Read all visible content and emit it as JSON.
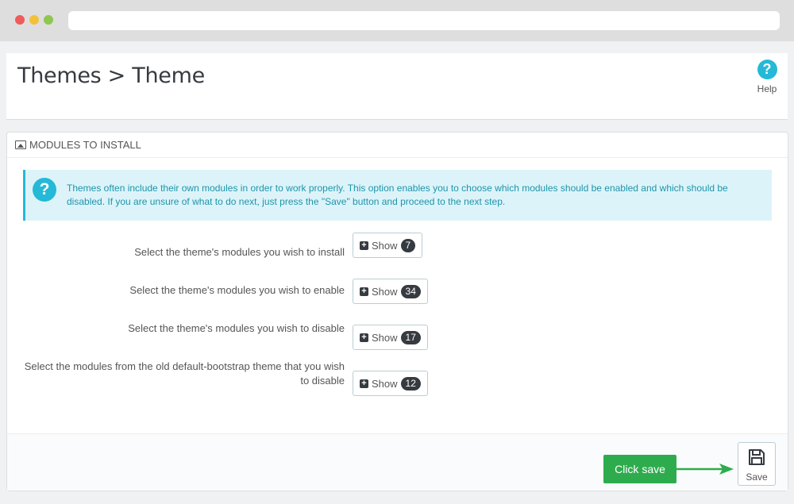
{
  "page": {
    "title": "Themes > Theme",
    "help_label": "Help"
  },
  "panel": {
    "heading": "MODULES TO INSTALL",
    "info_text": "Themes often include their own modules in order to work properly. This option enables you to choose which modules should be enabled and which should be disabled. If you are unsure of what to do next, just press the \"Save\" button and proceed to the next step.",
    "rows": [
      {
        "label": "Select the theme's modules you wish to install",
        "button": "Show",
        "count": "7"
      },
      {
        "label": "Select the theme's modules you wish to enable",
        "button": "Show",
        "count": "34"
      },
      {
        "label": "Select the theme's modules you wish to disable",
        "button": "Show",
        "count": "17"
      },
      {
        "label": "Select the modules from the old default-bootstrap theme that you wish to disable",
        "button": "Show",
        "count": "12"
      }
    ]
  },
  "footer": {
    "callout": "Click save",
    "save_label": "Save"
  },
  "icons": {
    "help": "question-circle-icon",
    "heading": "image-icon",
    "info": "question-circle-icon",
    "show": "plus-square-icon",
    "save": "floppy-disk-icon"
  },
  "colors": {
    "accent": "#25b9d7",
    "callout": "#2eac4d",
    "badge": "#363a41"
  }
}
